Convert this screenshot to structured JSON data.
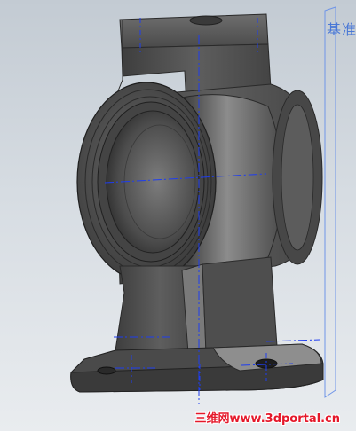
{
  "viewport": {
    "reference_plane_label": "基准",
    "watermark": "三维网www.3dportal.cn",
    "colors": {
      "background_top": "#c3cbd3",
      "background_bottom": "#e9ecef",
      "part_body": "#5a5a5a",
      "part_dark": "#2e2e2e",
      "part_light": "#8a8a8a",
      "axis_line": "#1e3df0",
      "reference_plane": "#6f95e8",
      "watermark": "#e5182a"
    }
  }
}
